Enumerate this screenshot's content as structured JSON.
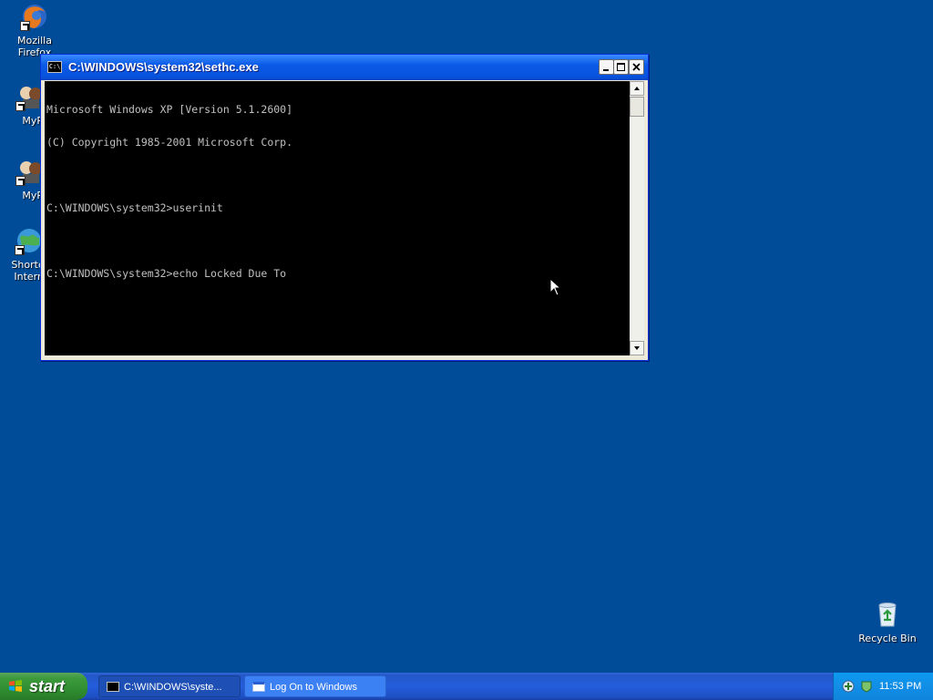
{
  "desktop": {
    "icons": [
      {
        "label": "Mozilla Firefox",
        "icon": "firefox-icon"
      },
      {
        "label": "MyP",
        "icon": "mypc-icon"
      },
      {
        "label": "MyP",
        "icon": "mypc-icon"
      },
      {
        "label": "Shortc Intern",
        "icon": "internet-icon"
      },
      {
        "label": "Recycle Bin",
        "icon": "recycle-bin-icon"
      }
    ]
  },
  "window": {
    "title": "C:\\WINDOWS\\system32\\sethc.exe",
    "console_lines": [
      "Microsoft Windows XP [Version 5.1.2600]",
      "(C) Copyright 1985-2001 Microsoft Corp.",
      "",
      "C:\\WINDOWS\\system32>userinit",
      "",
      "C:\\WINDOWS\\system32>echo Locked Due To"
    ]
  },
  "taskbar": {
    "start_label": "start",
    "tasks": [
      {
        "label": "C:\\WINDOWS\\syste...",
        "icon": "console-icon"
      },
      {
        "label": "Log On to Windows",
        "icon": "window-icon"
      }
    ],
    "clock": "11:53 PM"
  },
  "colors": {
    "desktop_bg": "#004c98",
    "titlebar": "#0a5ae6",
    "start": "#3c9a3c",
    "tray": "#1290e8"
  }
}
